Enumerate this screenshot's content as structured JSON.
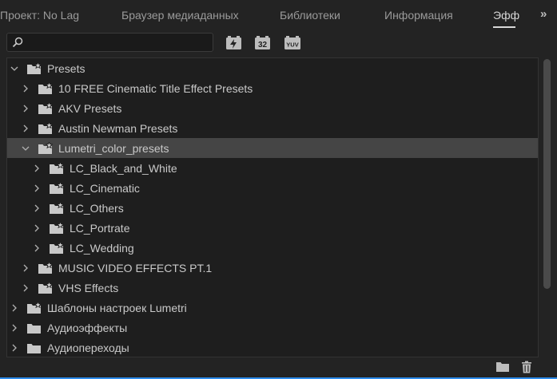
{
  "tabs": [
    {
      "label": "Проект: No Lag"
    },
    {
      "label": "Браузер медиаданных"
    },
    {
      "label": "Библиотеки"
    },
    {
      "label": "Информация"
    },
    {
      "label": "Эфф"
    }
  ],
  "overflow_label": "»",
  "search": {
    "placeholder": "",
    "value": ""
  },
  "toolbar_buttons": [
    {
      "icon": "accelerated-effects-icon"
    },
    {
      "icon": "32-bit-color-icon",
      "text": "32"
    },
    {
      "icon": "yuv-effects-icon",
      "text": "YUV"
    }
  ],
  "tree": [
    {
      "label": "Presets",
      "expanded": true
    },
    {
      "label": "10 FREE Cinematic Title Effect Presets",
      "expanded": false
    },
    {
      "label": "AKV Presets",
      "expanded": false
    },
    {
      "label": "Austin Newman Presets",
      "expanded": false
    },
    {
      "label": "Lumetri_color_presets",
      "expanded": true,
      "selected": true
    },
    {
      "label": "LC_Black_and_White",
      "expanded": false
    },
    {
      "label": "LC_Cinematic",
      "expanded": false
    },
    {
      "label": "LC_Others",
      "expanded": false
    },
    {
      "label": "LC_Portrate",
      "expanded": false
    },
    {
      "label": "LC_Wedding",
      "expanded": false
    },
    {
      "label": "MUSIC VIDEO EFFECTS PT.1",
      "expanded": false
    },
    {
      "label": "VHS Effects",
      "expanded": false
    },
    {
      "label": "Шаблоны настроек Lumetri",
      "expanded": false
    },
    {
      "label": "Аудиоэффекты",
      "expanded": false
    },
    {
      "label": "Аудиопереходы",
      "expanded": false
    }
  ],
  "colors": {
    "accent": "#2d8ceb",
    "selected_row": "#454545",
    "icon": "#c8c8c8"
  }
}
